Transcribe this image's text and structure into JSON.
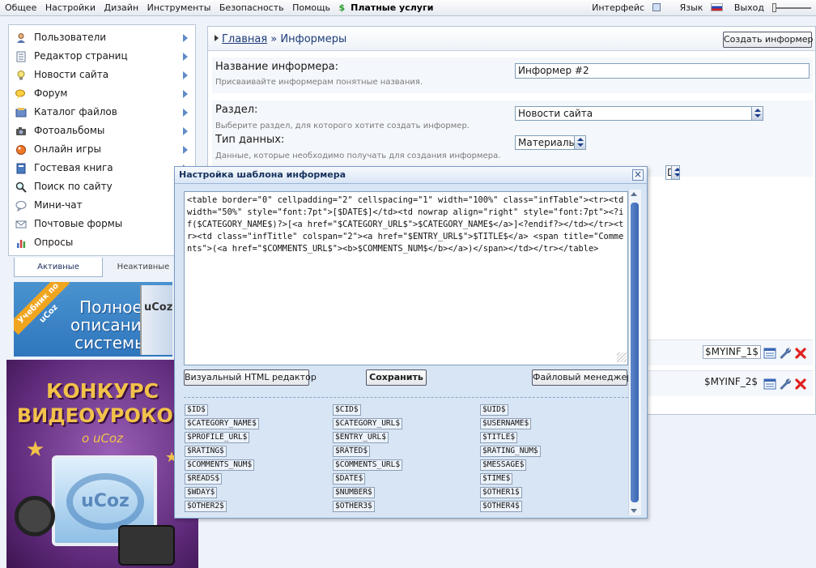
{
  "topbar": {
    "menu": [
      "Общее",
      "Настройки",
      "Дизайн",
      "Инструменты",
      "Безопасность",
      "Помощь"
    ],
    "paid_label": "Платные услуги",
    "paid_icon": "dollar-icon",
    "interface_label": "Интерфейс",
    "language_label": "Язык",
    "logout_label": "Выход"
  },
  "sidebar": {
    "items": [
      {
        "label": "Пользователи",
        "icon": "users-icon"
      },
      {
        "label": "Редактор страниц",
        "icon": "pages-icon"
      },
      {
        "label": "Новости сайта",
        "icon": "news-icon"
      },
      {
        "label": "Форум",
        "icon": "forum-icon"
      },
      {
        "label": "Каталог файлов",
        "icon": "files-icon"
      },
      {
        "label": "Фотоальбомы",
        "icon": "photo-icon"
      },
      {
        "label": "Онлайн игры",
        "icon": "games-icon"
      },
      {
        "label": "Гостевая книга",
        "icon": "guestbook-icon"
      },
      {
        "label": "Поиск по сайту",
        "icon": "search-icon"
      },
      {
        "label": "Мини-чат",
        "icon": "chat-icon"
      },
      {
        "label": "Почтовые формы",
        "icon": "mail-icon"
      },
      {
        "label": "Опросы",
        "icon": "poll-icon"
      }
    ],
    "tabs": {
      "active": "Активные",
      "inactive": "Неактивные"
    }
  },
  "banners": {
    "textbook": {
      "ribbon": "Учебник по uCoz",
      "lines": [
        "Полное",
        "описание",
        "системы"
      ],
      "book_brand": "uCoz"
    },
    "contest": {
      "lines": [
        "КОНКУРС",
        "ВИДЕОУРОКОВ"
      ],
      "sub": "o uCoz",
      "screen_logo": "uCoz"
    }
  },
  "breadcrumb": {
    "home": "Главная",
    "separator": " » ",
    "current": "Информеры"
  },
  "toolbar": {
    "create_label": "Создать информер"
  },
  "form": {
    "name": {
      "label": "Название информера:",
      "hint": "Присваивайте информерам понятные названия.",
      "value": "Информер #2"
    },
    "section": {
      "label": "Раздел:",
      "hint": "Выберите раздел, для которого хотите создать информер.",
      "value": "Новости сайта"
    },
    "data_type": {
      "label": "Тип данных:",
      "hint": "Данные, которые необходимо получать для создания информера.",
      "value": "Материалы"
    },
    "hidden_select_value": "D"
  },
  "informers": [
    {
      "code": "$MYINF_1$"
    },
    {
      "code": "$MYINF_2$"
    }
  ],
  "modal": {
    "title": "Настройка шаблона информера",
    "close_icon": "close-icon",
    "code": "<table border=\"0\" cellpadding=\"2\" cellspacing=\"1\" width=\"100%\" class=\"infTable\"><tr><td width=\"50%\" style=\"font:7pt\">[$DATE$]</td><td nowrap align=\"right\" style=\"font:7pt\"><?if($CATEGORY_NAME$)?>[<a href=\"$CATEGORY_URL$\">$CATEGORY_NAME$</a>]<?endif?></td></tr><tr><td class=\"infTitle\" colspan=\"2\"><a href=\"$ENTRY_URL$\">$TITLE$</a> <span title=\"Comments\">(<a href=\"$COMMENTS_URL$\"><b>$COMMENTS_NUM$</b></a>)</span></td></tr></table>",
    "buttons": {
      "visual": "Визуальный HTML редактор",
      "save": "Сохранить",
      "file_manager": "Файловый менеджер"
    },
    "variables": [
      [
        "$ID$",
        "$CID$",
        "$UID$"
      ],
      [
        "$CATEGORY_NAME$",
        "$CATEGORY_URL$",
        "$USERNAME$"
      ],
      [
        "$PROFILE_URL$",
        "$ENTRY_URL$",
        "$TITLE$"
      ],
      [
        "$RATING$",
        "$RATED$",
        "$RATING_NUM$"
      ],
      [
        "$COMMENTS_NUM$",
        "$COMMENTS_URL$",
        "$MESSAGE$"
      ],
      [
        "$READS$",
        "$DATE$",
        "$TIME$"
      ],
      [
        "$WDAY$",
        "$NUMBER$",
        "$OTHER1$"
      ],
      [
        "$OTHER2$",
        "$OTHER3$",
        "$OTHER4$"
      ]
    ]
  },
  "colors": {
    "accent": "#1d3c78",
    "delete": "#e02020",
    "scroll_thumb": "#3a68b6"
  }
}
